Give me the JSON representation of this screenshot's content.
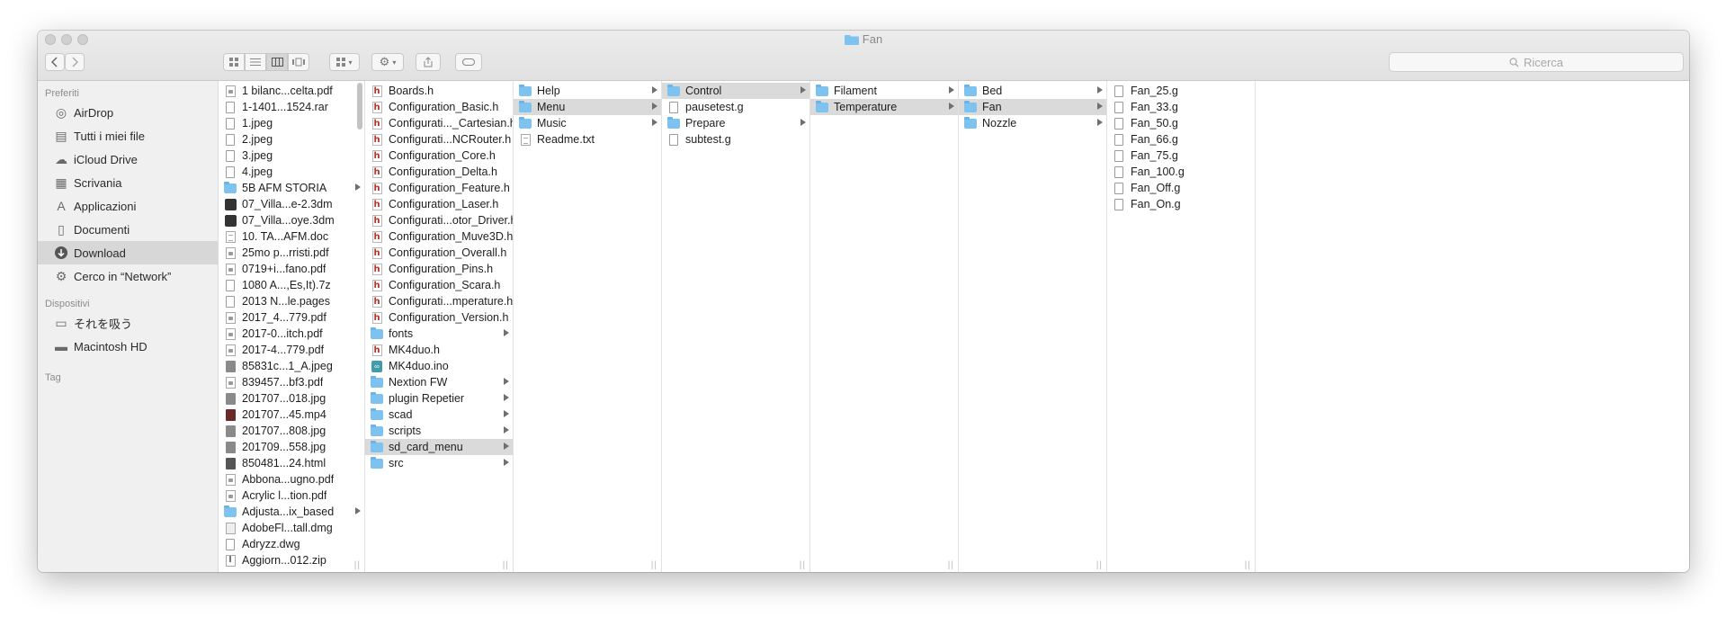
{
  "window": {
    "title": "Fan"
  },
  "toolbar": {
    "back_icon": "chevron-left-icon",
    "forward_icon": "chevron-right-icon",
    "search_placeholder": "Ricerca"
  },
  "sidebar": {
    "favorites_heading": "Preferiti",
    "favorites": [
      {
        "label": "AirDrop",
        "icon": "airdrop-icon"
      },
      {
        "label": "Tutti i miei file",
        "icon": "all-files-icon"
      },
      {
        "label": "iCloud Drive",
        "icon": "cloud-icon"
      },
      {
        "label": "Scrivania",
        "icon": "desktop-icon"
      },
      {
        "label": "Applicazioni",
        "icon": "applications-icon"
      },
      {
        "label": "Documenti",
        "icon": "documents-icon"
      },
      {
        "label": "Download",
        "icon": "download-icon"
      },
      {
        "label": "Cerco in “Network”",
        "icon": "network-icon"
      }
    ],
    "devices_heading": "Dispositivi",
    "devices": [
      {
        "label": "それを吸う",
        "icon": "computer-icon"
      },
      {
        "label": "Macintosh HD",
        "icon": "hard-drive-icon"
      }
    ],
    "tags_heading": "Tag"
  },
  "col1": [
    {
      "label": "1 bilanc...celta.pdf"
    },
    {
      "label": "1-1401...1524.rar"
    },
    {
      "label": "1.jpeg"
    },
    {
      "label": "2.jpeg"
    },
    {
      "label": "3.jpeg"
    },
    {
      "label": "4.jpeg"
    },
    {
      "label": "5B AFM STORIA"
    },
    {
      "label": "07_Villa...e-2.3dm"
    },
    {
      "label": "07_Villa...oye.3dm"
    },
    {
      "label": "10.    TA...AFM.doc"
    },
    {
      "label": "25mo p...rristi.pdf"
    },
    {
      "label": "0719+i...fano.pdf"
    },
    {
      "label": "1080 A...,Es,It).7z"
    },
    {
      "label": "2013 N...le.pages"
    },
    {
      "label": "2017_4...779.pdf"
    },
    {
      "label": "2017-0...itch.pdf"
    },
    {
      "label": "2017-4...779.pdf"
    },
    {
      "label": "85831c...1_A.jpeg"
    },
    {
      "label": "839457...bf3.pdf"
    },
    {
      "label": "201707...018.jpg"
    },
    {
      "label": "201707...45.mp4"
    },
    {
      "label": "201707...808.jpg"
    },
    {
      "label": "201709...558.jpg"
    },
    {
      "label": "850481...24.html"
    },
    {
      "label": "Abbona...ugno.pdf"
    },
    {
      "label": "Acrylic l...tion.pdf"
    },
    {
      "label": "Adjusta...ix_based"
    },
    {
      "label": "AdobeFl...tall.dmg"
    },
    {
      "label": "Adryzz.dwg"
    },
    {
      "label": "Aggiorn...012.zip"
    }
  ],
  "col2": [
    {
      "label": "Boards.h"
    },
    {
      "label": "Configuration_Basic.h"
    },
    {
      "label": "Configurati..._Cartesian.h"
    },
    {
      "label": "Configurati...NCRouter.h"
    },
    {
      "label": "Configuration_Core.h"
    },
    {
      "label": "Configuration_Delta.h"
    },
    {
      "label": "Configuration_Feature.h"
    },
    {
      "label": "Configuration_Laser.h"
    },
    {
      "label": "Configurati...otor_Driver.h"
    },
    {
      "label": "Configuration_Muve3D.h"
    },
    {
      "label": "Configuration_Overall.h"
    },
    {
      "label": "Configuration_Pins.h"
    },
    {
      "label": "Configuration_Scara.h"
    },
    {
      "label": "Configurati...mperature.h"
    },
    {
      "label": "Configuration_Version.h"
    },
    {
      "label": "fonts"
    },
    {
      "label": "MK4duo.h"
    },
    {
      "label": "MK4duo.ino"
    },
    {
      "label": "Nextion FW"
    },
    {
      "label": "plugin Repetier"
    },
    {
      "label": "scad"
    },
    {
      "label": "scripts"
    },
    {
      "label": "sd_card_menu"
    },
    {
      "label": "src"
    }
  ],
  "col3": [
    {
      "label": "Help"
    },
    {
      "label": "Menu"
    },
    {
      "label": "Music"
    },
    {
      "label": "Readme.txt"
    }
  ],
  "col4": [
    {
      "label": "Control"
    },
    {
      "label": "pausetest.g"
    },
    {
      "label": "Prepare"
    },
    {
      "label": "subtest.g"
    }
  ],
  "col5": [
    {
      "label": "Filament"
    },
    {
      "label": "Temperature"
    }
  ],
  "col6": [
    {
      "label": "Bed"
    },
    {
      "label": "Fan"
    },
    {
      "label": "Nozzle"
    }
  ],
  "col7": [
    {
      "label": "Fan_25.g"
    },
    {
      "label": "Fan_33.g"
    },
    {
      "label": "Fan_50.g"
    },
    {
      "label": "Fan_66.g"
    },
    {
      "label": "Fan_75.g"
    },
    {
      "label": "Fan_100.g"
    },
    {
      "label": "Fan_Off.g"
    },
    {
      "label": "Fan_On.g"
    }
  ]
}
